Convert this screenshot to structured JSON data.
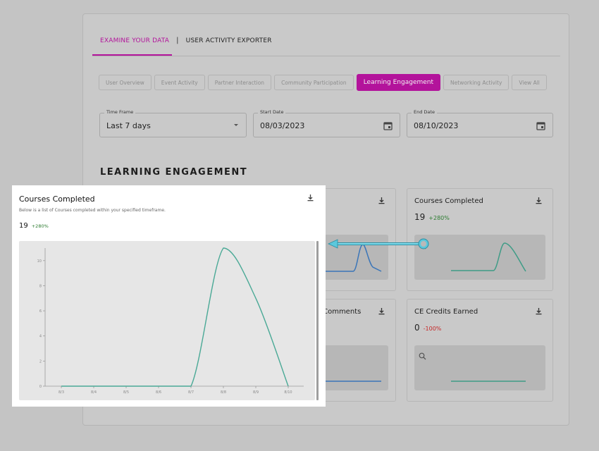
{
  "tabs": {
    "active": "EXAMINE YOUR DATA",
    "separator": "|",
    "other": "USER ACTIVITY EXPORTER"
  },
  "filters": [
    {
      "label": "User Overview",
      "active": false
    },
    {
      "label": "Event Activity",
      "active": false
    },
    {
      "label": "Partner Interaction",
      "active": false
    },
    {
      "label": "Community Participation",
      "active": false
    },
    {
      "label": "Learning Engagement",
      "active": true
    },
    {
      "label": "Networking Activity",
      "active": false
    },
    {
      "label": "View All",
      "active": false
    }
  ],
  "fields": {
    "time_frame": {
      "label": "Time Frame",
      "value": "Last 7 days"
    },
    "start_date": {
      "label": "Start Date",
      "value": "08/03/2023"
    },
    "end_date": {
      "label": "End Date",
      "value": "08/10/2023"
    }
  },
  "section_title": "LEARNING ENGAGEMENT",
  "cards": {
    "courses_completed": {
      "title": "Courses Completed",
      "value": "19",
      "change": "+280%"
    },
    "activity_comments": {
      "title": "y Comments"
    },
    "ce_credits": {
      "title": "CE Credits Earned",
      "value": "0",
      "change": "-100%"
    }
  },
  "popup": {
    "title": "Courses Completed",
    "description": "Below is a list of Courses completed within your specified timeframe.",
    "value": "19",
    "change": "+280%"
  },
  "chart_data": {
    "type": "line",
    "x": [
      "8/3",
      "8/4",
      "8/5",
      "8/6",
      "8/7",
      "8/8",
      "8/9",
      "8/10"
    ],
    "values": [
      0,
      0,
      0,
      0,
      0,
      11,
      7,
      0
    ],
    "yticks": [
      0,
      2,
      4,
      6,
      8,
      10
    ],
    "ylim": [
      0,
      11
    ],
    "color": "#4aa996"
  },
  "colors": {
    "accent": "#b3139b",
    "up": "#2e7d32",
    "down": "#c62828",
    "arrow": "#5cc8dc"
  },
  "icons": {
    "download": "download-icon",
    "calendar": "calendar-icon",
    "dropdown": "chevron-down-icon",
    "zoom": "zoom-icon"
  }
}
